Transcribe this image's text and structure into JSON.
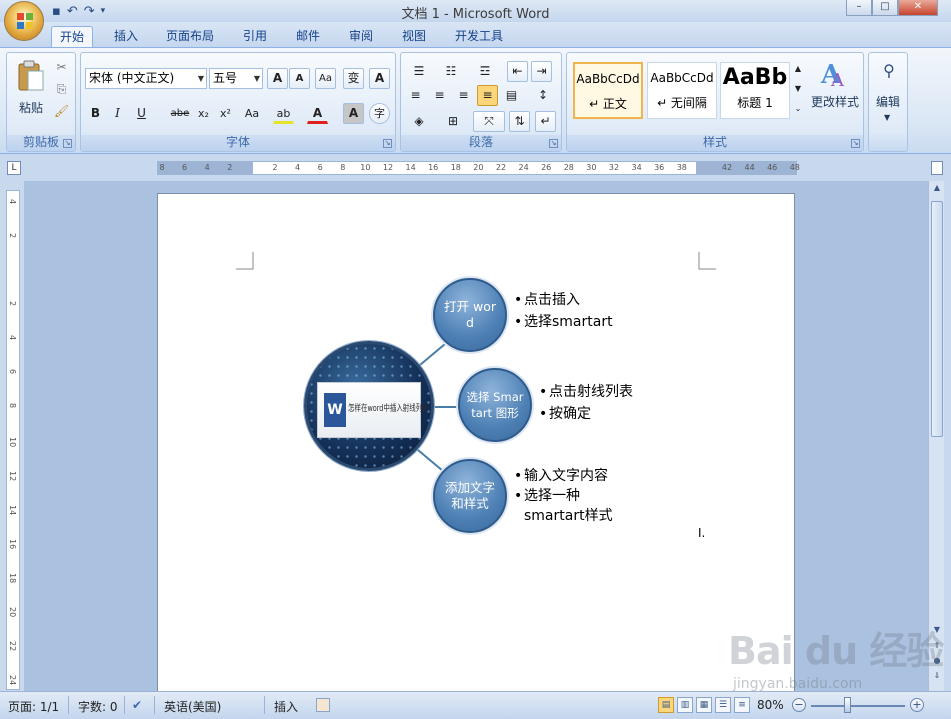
{
  "window": {
    "title": "文档 1 - Microsoft Word",
    "controls": {
      "minimize": "–",
      "maximize": "□",
      "close": "✕"
    }
  },
  "quick_access": {
    "save_icon": "save-icon",
    "undo_icon": "undo-icon",
    "redo_icon": "redo-icon"
  },
  "tabs": [
    {
      "label": "开始",
      "active": true
    },
    {
      "label": "插入"
    },
    {
      "label": "页面布局"
    },
    {
      "label": "引用"
    },
    {
      "label": "邮件"
    },
    {
      "label": "审阅"
    },
    {
      "label": "视图"
    },
    {
      "label": "开发工具"
    }
  ],
  "ribbon": {
    "clipboard": {
      "label": "剪贴板",
      "paste": "粘贴"
    },
    "font": {
      "label": "字体",
      "font_name": "宋体 (中文正文)",
      "font_size": "五号",
      "grow": "A",
      "shrink": "A",
      "clear": "Aa",
      "phonetic": "变",
      "border": "A",
      "bold": "B",
      "italic": "I",
      "underline": "U",
      "strike": "abe",
      "subscript": "x₂",
      "superscript": "x²",
      "case": "Aa",
      "highlight": "ab",
      "color": "A",
      "shading": "A",
      "enclose": "字"
    },
    "paragraph": {
      "label": "段落"
    },
    "styles": {
      "label": "样式",
      "items": [
        {
          "sample": "AaBbCcDd",
          "name": "↵ 正文",
          "selected": true
        },
        {
          "sample": "AaBbCcDd",
          "name": "↵ 无间隔"
        },
        {
          "sample": "AaBb",
          "name": "标题 1"
        }
      ],
      "change_styles": "更改样式"
    },
    "editing": {
      "label": "编辑"
    }
  },
  "ruler": {
    "h_ticks": [
      "8",
      "6",
      "4",
      "2",
      "",
      "2",
      "4",
      "6",
      "8",
      "10",
      "12",
      "14",
      "16",
      "18",
      "20",
      "22",
      "24",
      "26",
      "28",
      "30",
      "32",
      "34",
      "36",
      "38",
      "",
      "42",
      "44",
      "46",
      "48"
    ],
    "v_ticks": [
      "4",
      "2",
      "",
      "2",
      "4",
      "6",
      "8",
      "10",
      "12",
      "14",
      "16",
      "18",
      "20",
      "22",
      "24"
    ]
  },
  "smartart": {
    "hub_text": "怎样在word中插入射线列表",
    "nodes": [
      {
        "label": "打开 word",
        "bullets": [
          "点击插入",
          "选择smartart"
        ]
      },
      {
        "label": "选择 Smartart 图形",
        "bullets": [
          "点击射线列表",
          "按确定"
        ]
      },
      {
        "label": "添加文字和样式",
        "bullets": [
          "输入文字内容",
          "选择一种",
          "smartart样式"
        ]
      }
    ]
  },
  "status_bar": {
    "page": "页面: 1/1",
    "words": "字数: 0",
    "language": "英语(美国)",
    "mode": "插入",
    "zoom": "80%",
    "zoom_level": 0.8
  },
  "watermark": {
    "brand": "Bai du 经验",
    "url": "jingyan.baidu.com"
  },
  "colors": {
    "accent": "#15428b",
    "ribbon_bg": "#dbe7f5",
    "node_fill": "#4c7fb4",
    "hub_fill": "#15325a"
  }
}
